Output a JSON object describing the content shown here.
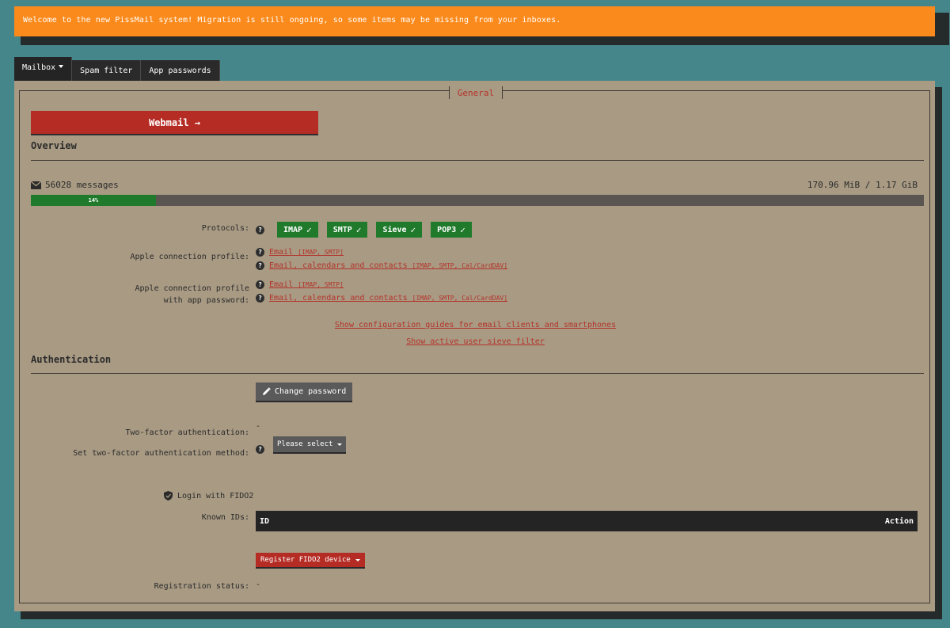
{
  "banner": {
    "text": "Welcome to the new PissMail system! Migration is still ongoing, so some items may be missing from your inboxes."
  },
  "tabs": [
    {
      "label": "Mailbox"
    },
    {
      "label": "Spam filter"
    },
    {
      "label": "App passwords"
    }
  ],
  "general": {
    "legend": "General",
    "webmail_label": "Webmail →"
  },
  "overview": {
    "title": "Overview",
    "messages": "56028 messages",
    "size": "170.96 MiB / 1.17 GiB",
    "quota_percent_label": "14%",
    "quota_fraction": 0.14,
    "protocols_label": "Protocols:",
    "protocols": [
      "IMAP",
      "SMTP",
      "Sieve",
      "POP3"
    ],
    "apple_profile_label": "Apple connection profile:",
    "apple_profile_links": [
      {
        "text": "Email",
        "small": "[IMAP, SMTP]"
      },
      {
        "text": "Email, calendars and contacts",
        "small": "[IMAP, SMTP, Cal/CardDAV]"
      }
    ],
    "apple_app_label_1": "Apple connection profile",
    "apple_app_label_2": "with app password:",
    "apple_app_links": [
      {
        "text": "Email",
        "small": "[IMAP, SMTP]"
      },
      {
        "text": "Email, calendars and contacts",
        "small": "[IMAP, SMTP, Cal/CardDAV]"
      }
    ],
    "config_guides_link": "Show configuration guides for email clients and smartphones",
    "sieve_filter_link": "Show active user sieve filter"
  },
  "authentication": {
    "title": "Authentication",
    "change_password_label": "Change password",
    "tfa_label": "Two-factor authentication:",
    "tfa_value": "-",
    "tfa_method_label": "Set two-factor authentication method:",
    "tfa_method_select": "Please select",
    "fido_label": "Login with FIDO2",
    "known_ids_label": "Known IDs:",
    "table_id_header": "ID",
    "table_action_header": "Action",
    "register_label": "Register FIDO2 device",
    "registration_status_label": "Registration status:",
    "registration_status_value": "-"
  },
  "colors": {
    "background": "#45868a",
    "banner": "#fb8a1c",
    "panel": "#a89a83",
    "accent_red": "#b52c25",
    "success_green": "#207a2c",
    "dark": "#242424"
  },
  "icons": {
    "envelope": "envelope-icon",
    "question": "question-icon",
    "check": "check-icon",
    "pencil": "pencil-icon",
    "shield": "shield-icon"
  }
}
